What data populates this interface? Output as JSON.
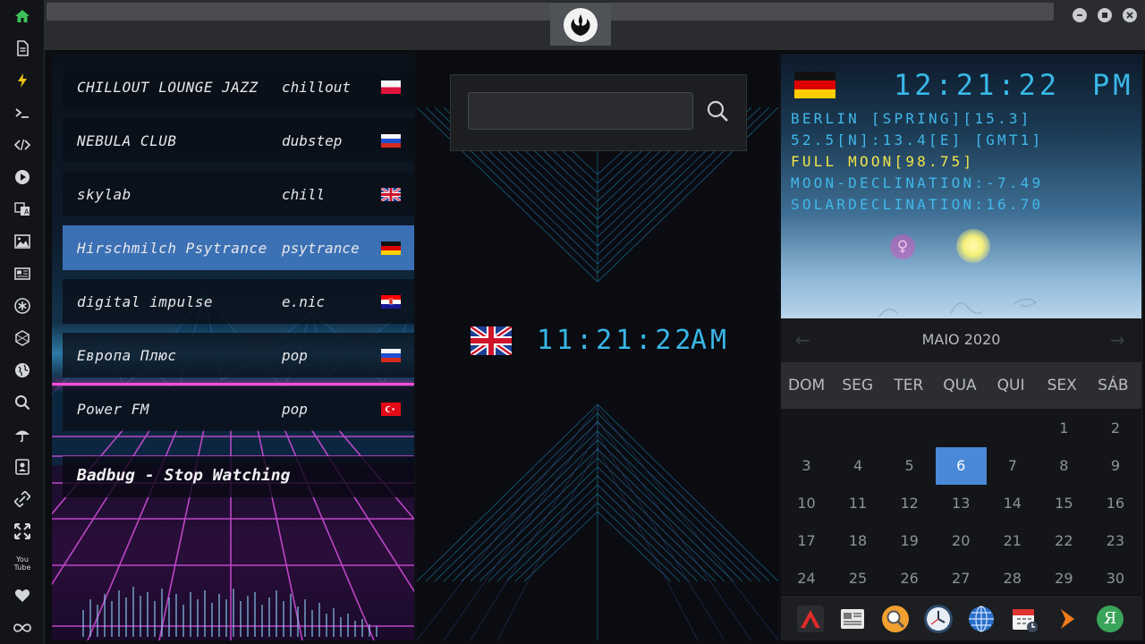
{
  "sidebar": {
    "icons": [
      "home-icon",
      "document-icon",
      "lightning-icon",
      "terminal-icon",
      "code-icon",
      "play-icon",
      "translate-icon",
      "image-icon",
      "news-icon",
      "asterisk-icon",
      "hexagon-icon",
      "globe-icon",
      "search-icon",
      "umbrella-icon",
      "contact-icon",
      "link-icon",
      "expand-icon",
      "youtube-icon",
      "heart-icon",
      "infinity-icon"
    ],
    "youtube_label": "You Tube"
  },
  "stations": [
    {
      "name": "CHILLOUT LOUNGE JAZZ",
      "genre": "chillout",
      "flag": "Poland"
    },
    {
      "name": "NEBULA CLUB",
      "genre": "dubstep",
      "flag": "Russia"
    },
    {
      "name": "skylab",
      "genre": "chill",
      "flag": "United Kingdom"
    },
    {
      "name": "Hirschmilch Psytrance",
      "genre": "psytrance",
      "flag": "Germany",
      "selected": true
    },
    {
      "name": "digital impulse",
      "genre": "e.nic",
      "flag": "Croatia"
    },
    {
      "name": "Европа Плюс",
      "genre": "pop",
      "flag": "Russia"
    },
    {
      "name": "Power FM",
      "genre": "pop",
      "flag": "Turkey"
    }
  ],
  "now_playing": "Badbug - Stop Watching",
  "search": {
    "value": "",
    "placeholder": ""
  },
  "uk_clock": {
    "time": "11:21:22",
    "ampm": "AM"
  },
  "world_clock": {
    "time": "12:21:22",
    "ampm": "PM",
    "lines": [
      {
        "text": "BERLIN [SPRING][15.3]",
        "color": "#40b8ea"
      },
      {
        "text": "52.5[N]:13.4[E] [GMT1]",
        "color": "#40b8ea"
      },
      {
        "text": "FULL MOON[98.75]",
        "color": "#f1e54a"
      },
      {
        "text": "MOON-DECLINATION:-7.49",
        "color": "#40b8ea"
      },
      {
        "text": "SOLARDECLINATION:16.70",
        "color": "#40b8ea"
      }
    ],
    "venus_symbol": "♀"
  },
  "calendar": {
    "month_label": "MAIO 2020",
    "prev_symbol": "←",
    "next_symbol": "→",
    "weekdays": [
      "DOM",
      "SEG",
      "TER",
      "QUA",
      "QUI",
      "SEX",
      "SÁB"
    ],
    "first_weekday_index": 5,
    "visible_days": 30,
    "today": 6
  },
  "dock": {
    "icons": [
      "arrow-app-icon",
      "newspaper-app-icon",
      "search-app-icon",
      "clock-app-icon",
      "globe-app-icon",
      "calendar-app-icon",
      "forward-app-icon",
      "yandex-app-icon"
    ],
    "yandex_letter": "Я"
  },
  "colors": {
    "accent_blue": "#39b7e8",
    "selected_row": "#4682d2",
    "today": "#4a88d8",
    "sidebar_active": "#3fbf5a",
    "sidebar_warn": "#f0c419"
  }
}
